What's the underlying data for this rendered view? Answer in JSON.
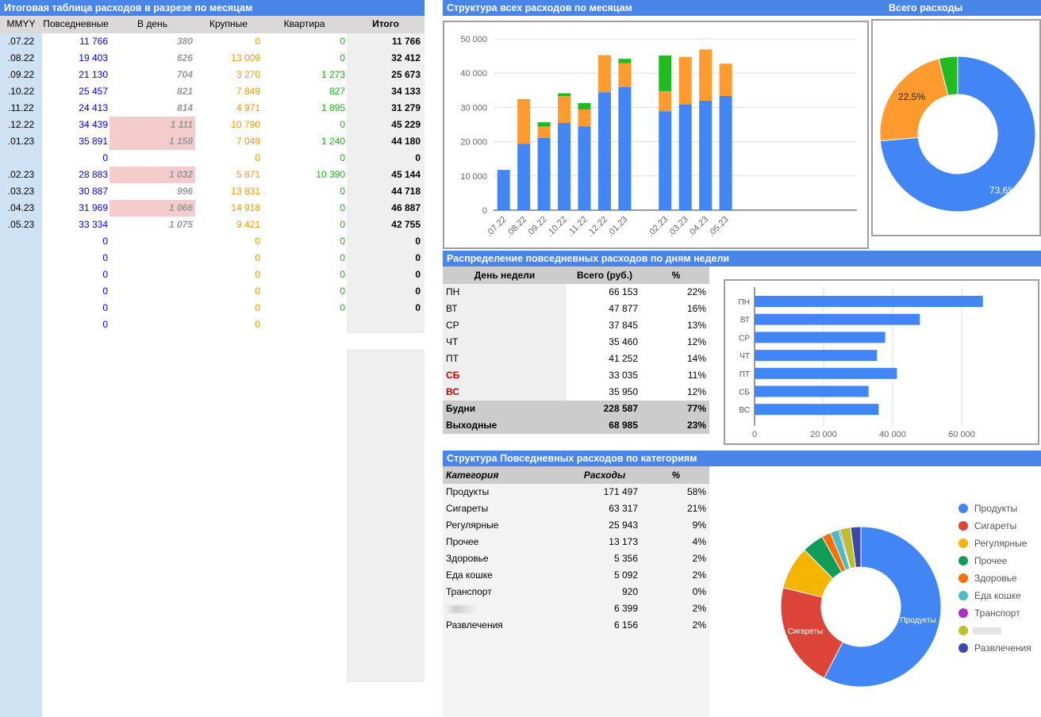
{
  "monthly": {
    "title": "Итоговая таблица расходов в разрезе по месяцам",
    "headers": [
      "MMYY",
      "Повседневные",
      "В день",
      "Крупные",
      "Квартира",
      "Итого"
    ],
    "rows": [
      {
        "m": ".07.22",
        "daily": "11 766",
        "perday": "380",
        "big": "0",
        "flat": "0",
        "total": "11 766",
        "hl": false
      },
      {
        "m": ".08.22",
        "daily": "19 403",
        "perday": "626",
        "big": "13 009",
        "flat": "0",
        "total": "32 412",
        "hl": false
      },
      {
        "m": ".09.22",
        "daily": "21 130",
        "perday": "704",
        "big": "3 270",
        "flat": "1 273",
        "total": "25 673",
        "hl": false
      },
      {
        "m": ".10.22",
        "daily": "25 457",
        "perday": "821",
        "big": "7 849",
        "flat": "827",
        "total": "34 133",
        "hl": false
      },
      {
        "m": ".11.22",
        "daily": "24 413",
        "perday": "814",
        "big": "4 971",
        "flat": "1 895",
        "total": "31 279",
        "hl": false
      },
      {
        "m": ".12.22",
        "daily": "34 439",
        "perday": "1 111",
        "big": "10 790",
        "flat": "0",
        "total": "45 229",
        "hl": true
      },
      {
        "m": ".01.23",
        "daily": "35 891",
        "perday": "1 158",
        "big": "7 049",
        "flat": "1 240",
        "total": "44 180",
        "hl": true
      },
      {
        "m": "",
        "daily": "0",
        "perday": "",
        "big": "0",
        "flat": "0",
        "total": "0",
        "hl": false
      },
      {
        "m": ".02.23",
        "daily": "28 883",
        "perday": "1 032",
        "big": "5 871",
        "flat": "10 390",
        "total": "45 144",
        "hl": true
      },
      {
        "m": ".03.23",
        "daily": "30 887",
        "perday": "996",
        "big": "13 831",
        "flat": "0",
        "total": "44 718",
        "hl": false
      },
      {
        "m": ".04.23",
        "daily": "31 969",
        "perday": "1 066",
        "big": "14 918",
        "flat": "0",
        "total": "46 887",
        "hl": true
      },
      {
        "m": ".05.23",
        "daily": "33 334",
        "perday": "1 075",
        "big": "9 421",
        "flat": "0",
        "total": "42 755",
        "hl": false
      },
      {
        "m": "",
        "daily": "0",
        "perday": "",
        "big": "0",
        "flat": "0",
        "total": "0",
        "hl": false
      },
      {
        "m": "",
        "daily": "0",
        "perday": "",
        "big": "0",
        "flat": "0",
        "total": "0",
        "hl": false
      },
      {
        "m": "",
        "daily": "0",
        "perday": "",
        "big": "0",
        "flat": "0",
        "total": "0",
        "hl": false
      },
      {
        "m": "",
        "daily": "0",
        "perday": "",
        "big": "0",
        "flat": "0",
        "total": "0",
        "hl": false
      },
      {
        "m": "",
        "daily": "0",
        "perday": "",
        "big": "0",
        "flat": "0",
        "total": "0",
        "hl": false
      },
      {
        "m": "",
        "daily": "0",
        "perday": "",
        "big": "0",
        "flat": "",
        "total": "",
        "hl": false
      }
    ]
  },
  "colors": {
    "header": "#4a86e8",
    "blue": "#4285f4",
    "orange": "#ff9a2e",
    "green": "#1fbb1f",
    "text_daily": "#0000ff",
    "text_big": "#ff9900",
    "text_flat": "#14b814",
    "highlight": "#f4cccc",
    "weekend": "#cc0000"
  },
  "chart_data": [
    {
      "type": "bar",
      "stacked": true,
      "title": "Структура всех расходов по месяцам",
      "categories": [
        ".07.22",
        ".08.22",
        ".09.22",
        ".10.22",
        ".11.22",
        ".12.22",
        ".01.23",
        "",
        ".02.23",
        ".03.23",
        ".04.23",
        ".05.23",
        "",
        "",
        "",
        "",
        "",
        ""
      ],
      "series": [
        {
          "values": [
            11766,
            19403,
            21130,
            25457,
            24413,
            34439,
            35891,
            0,
            28883,
            30887,
            31969,
            33334,
            0,
            0,
            0,
            0,
            0,
            0
          ],
          "color": "#4285f4"
        },
        {
          "values": [
            0,
            13009,
            3270,
            7849,
            4971,
            10790,
            7049,
            0,
            5871,
            13831,
            14918,
            9421,
            0,
            0,
            0,
            0,
            0,
            0
          ],
          "color": "#ff9a2e"
        },
        {
          "values": [
            0,
            0,
            1273,
            827,
            1895,
            0,
            1240,
            0,
            10390,
            0,
            0,
            0,
            0,
            0,
            0,
            0,
            0,
            0
          ],
          "color": "#1fbb1f"
        }
      ],
      "ylim": [
        0,
        50000
      ],
      "yticks": [
        "0",
        "10 000",
        "20 000",
        "30 000",
        "40 000",
        "50 000"
      ],
      "grid": true
    },
    {
      "type": "pie",
      "donut": true,
      "title": "Всего расходы",
      "values": [
        73.6,
        22.5,
        3.9
      ],
      "labels": [
        "73,6%",
        "22,5%",
        ""
      ],
      "colors": [
        "#4285f4",
        "#ff9a2e",
        "#1fbb1f"
      ]
    },
    {
      "type": "bar",
      "orientation": "horizontal",
      "categories": [
        "ПН",
        "ВТ",
        "СР",
        "ЧТ",
        "ПТ",
        "СБ",
        "ВС"
      ],
      "values": [
        66153,
        47877,
        37845,
        35460,
        41252,
        33035,
        35950
      ],
      "xlim": [
        0,
        75000
      ],
      "xticks": [
        "0",
        "20 000",
        "40 000",
        "60 000"
      ],
      "grid": true,
      "color": "#4285f4"
    },
    {
      "type": "pie",
      "donut": true,
      "categories": [
        "Продукты",
        "Сигареты",
        "Регулярные",
        "Прочее",
        "Здоровье",
        "Еда кошке",
        "Транспорт",
        "",
        "Развлечения"
      ],
      "values": [
        171497,
        63317,
        25943,
        13173,
        5356,
        5092,
        920,
        6399,
        6156
      ],
      "colors": [
        "#4285f4",
        "#db4437",
        "#f4b400",
        "#0f9d58",
        "#ff6d01",
        "#46bdc6",
        "#ab30c4",
        "#c0bd2e",
        "#3949ab"
      ],
      "slice_labels": [
        "Продукты",
        "Сигареты"
      ],
      "legend": "right"
    }
  ],
  "weekday": {
    "title": "Распределение повседневных расходов по дням недели",
    "headers": [
      "День недели",
      "Всего (руб.)",
      "%"
    ],
    "rows": [
      {
        "d": "ПН",
        "v": "66 153",
        "p": "22%",
        "we": false
      },
      {
        "d": "ВТ",
        "v": "47 877",
        "p": "16%",
        "we": false
      },
      {
        "d": "СР",
        "v": "37 845",
        "p": "13%",
        "we": false
      },
      {
        "d": "ЧТ",
        "v": "35 460",
        "p": "12%",
        "we": false
      },
      {
        "d": "ПТ",
        "v": "41 252",
        "p": "14%",
        "we": false
      },
      {
        "d": "СБ",
        "v": "33 035",
        "p": "11%",
        "we": true
      },
      {
        "d": "ВС",
        "v": "35 950",
        "p": "12%",
        "we": true
      }
    ],
    "totals": [
      {
        "d": "Будни",
        "v": "228 587",
        "p": "77%"
      },
      {
        "d": "Выходные",
        "v": "68 985",
        "p": "23%"
      }
    ]
  },
  "categories": {
    "title": "Структура Повседневных расходов по категориям",
    "headers": [
      "Категория",
      "Расходы",
      "%"
    ],
    "rows": [
      {
        "c": "Продукты",
        "v": "171 497",
        "p": "58%"
      },
      {
        "c": "Сигареты",
        "v": "63 317",
        "p": "21%"
      },
      {
        "c": "Регулярные",
        "v": "25 943",
        "p": "9%"
      },
      {
        "c": "Прочее",
        "v": "13 173",
        "p": "4%"
      },
      {
        "c": "Здоровье",
        "v": "5 356",
        "p": "2%"
      },
      {
        "c": "Еда кошке",
        "v": "5 092",
        "p": "2%"
      },
      {
        "c": "Транспорт",
        "v": "920",
        "p": "0%"
      },
      {
        "c": "",
        "v": "6 399",
        "p": "2%"
      },
      {
        "c": "Развлечения",
        "v": "6 156",
        "p": "2%"
      }
    ]
  }
}
